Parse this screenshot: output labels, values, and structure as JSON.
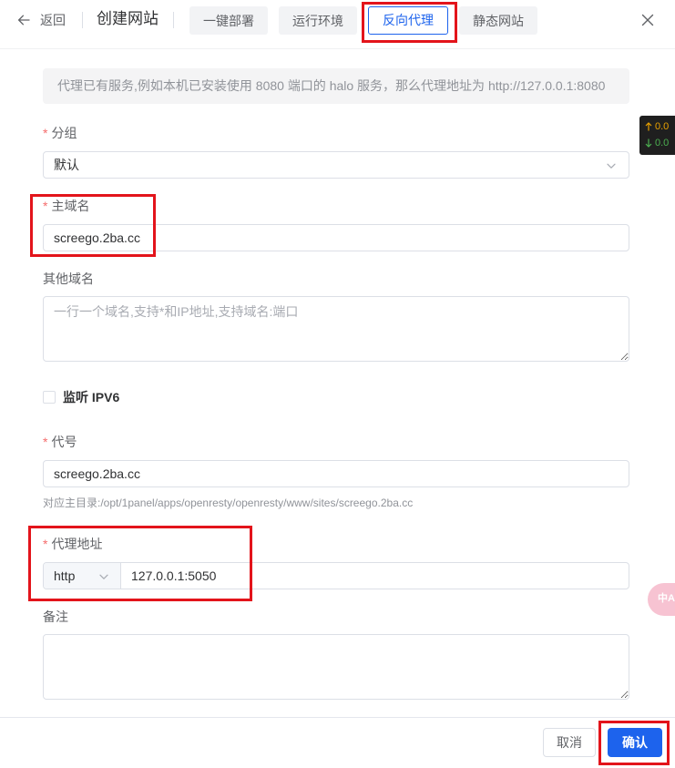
{
  "header": {
    "back_icon": "arrow-left-icon",
    "back_label": "返回",
    "title": "创建网站",
    "tabs": [
      {
        "label": "一键部署",
        "active": false
      },
      {
        "label": "运行环境",
        "active": false
      },
      {
        "label": "反向代理",
        "active": true
      },
      {
        "label": "静态网站",
        "active": false
      }
    ],
    "close_icon": "close-icon"
  },
  "notice": {
    "text": "代理已有服务,例如本机已安装使用 8080 端口的 halo 服务，那么代理地址为 http://127.0.0.1:8080"
  },
  "form": {
    "required_mark": "*",
    "group": {
      "label": "分组",
      "value": "默认",
      "icon": "chevron-down-icon"
    },
    "primary_domain": {
      "label": "主域名",
      "value": "screego.2ba.cc"
    },
    "other_domains": {
      "label": "其他域名",
      "placeholder": "一行一个域名,支持*和IP地址,支持域名:端口"
    },
    "ipv6": {
      "label": "监听 IPV6",
      "checked": false
    },
    "alias": {
      "label": "代号",
      "value": "screego.2ba.cc",
      "help": "对应主目录:/opt/1panel/apps/openresty/openresty/www/sites/screego.2ba.cc"
    },
    "proxy": {
      "label": "代理地址",
      "protocol": "http",
      "address": "127.0.0.1:5050",
      "icon": "chevron-down-icon"
    },
    "remark": {
      "label": "备注"
    }
  },
  "footer": {
    "cancel_label": "取消",
    "confirm_label": "确认"
  },
  "side_widgets": {
    "net_speed": {
      "up_icon": "arrow-up-icon",
      "up": "0.0",
      "down_icon": "arrow-down-icon",
      "down": "0.0"
    },
    "translate": {
      "icon": "translate-icon",
      "glyphs": "中A"
    }
  },
  "colors": {
    "accent": "#1d63ed",
    "required": "#f56c6c",
    "highlight": "#e3141b",
    "net_up": "#e8a100",
    "net_down": "#4caf50",
    "widget_bg": "#1f1f1f",
    "translate_bg": "#f7c3d2"
  }
}
